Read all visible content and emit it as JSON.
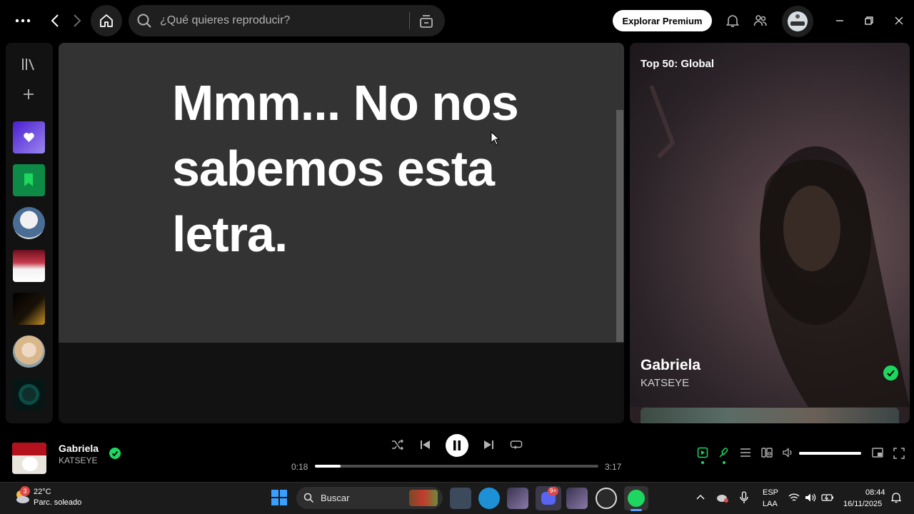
{
  "topbar": {
    "search_placeholder": "¿Qué quieres reproducir?",
    "premium_label": "Explorar Premium"
  },
  "lyrics": {
    "message": "Mmm... No nos sabemos esta letra."
  },
  "right_panel": {
    "playlist_title": "Top 50: Global",
    "song": "Gabriela",
    "artist": "KATSEYE"
  },
  "player": {
    "title": "Gabriela",
    "artist": "KATSEYE",
    "current_time": "0:18",
    "total_time": "3:17",
    "progress": 0.09,
    "volume": 1.0
  },
  "taskbar": {
    "weather_temp": "22°C",
    "weather_desc": "Parc. soleado",
    "weather_badge": "3",
    "search_label": "Buscar",
    "discord_badge": "9+",
    "lang_top": "ESP",
    "lang_bottom": "LAA",
    "time": "08:44",
    "date": "16/11/2025"
  },
  "colors": {
    "accent": "#1ed760",
    "panel": "#121212",
    "lyrics_bg": "#333333"
  }
}
